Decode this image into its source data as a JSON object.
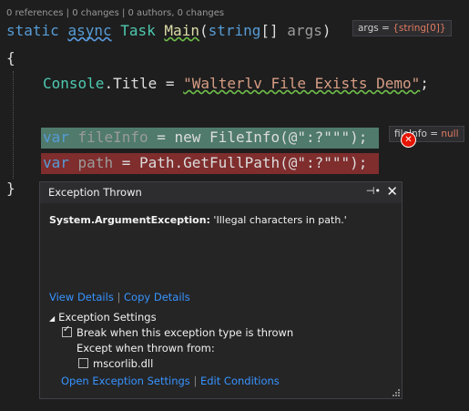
{
  "codelens": "0 references | 0 changes | 0 authors, 0 changes",
  "code": {
    "line1": {
      "kw1": "static",
      "kw2": "async",
      "type": "Task",
      "method": "Main",
      "paren_open": "(",
      "ptype": "string",
      "brackets": "[] ",
      "param": "args",
      "paren_close": ")"
    },
    "brace_open": "{",
    "line2": {
      "type": "Console",
      "dot": ".",
      "prop": "Title",
      "eq": " = ",
      "str": "\"Walterlv File Exists Demo\"",
      "semi": ";"
    },
    "line3": {
      "kw": "var",
      "name": "fileInfo",
      "rest1": " = new ",
      "type": "FileInfo",
      "rest2": "(@\":?\"\"\");"
    },
    "line4": {
      "kw": "var",
      "name": "path",
      "rest1": " = ",
      "type": "Path",
      "rest2": ".GetFullPath(@\":?\"\"\");"
    },
    "brace_close": "}"
  },
  "datatips": {
    "args": {
      "label": "args = ",
      "value": "{string[0]}"
    },
    "fileInfo": {
      "label": "fileInfo = ",
      "value": "null"
    }
  },
  "exception_popup": {
    "title": "Exception Thrown",
    "pin_icon": "pin-icon",
    "close_icon": "close-icon",
    "exception_type": "System.ArgumentException:",
    "exception_message": " 'Illegal characters in path.'",
    "view_details": "View Details",
    "copy_details": "Copy Details",
    "settings_header": "Exception Settings",
    "break_when_thrown": "Break when this exception type is thrown",
    "break_checked": true,
    "except_when_from": "Except when thrown from:",
    "mscorlib": "mscorlib.dll",
    "mscorlib_checked": false,
    "open_settings": "Open Exception Settings",
    "edit_conditions": "Edit Conditions"
  }
}
